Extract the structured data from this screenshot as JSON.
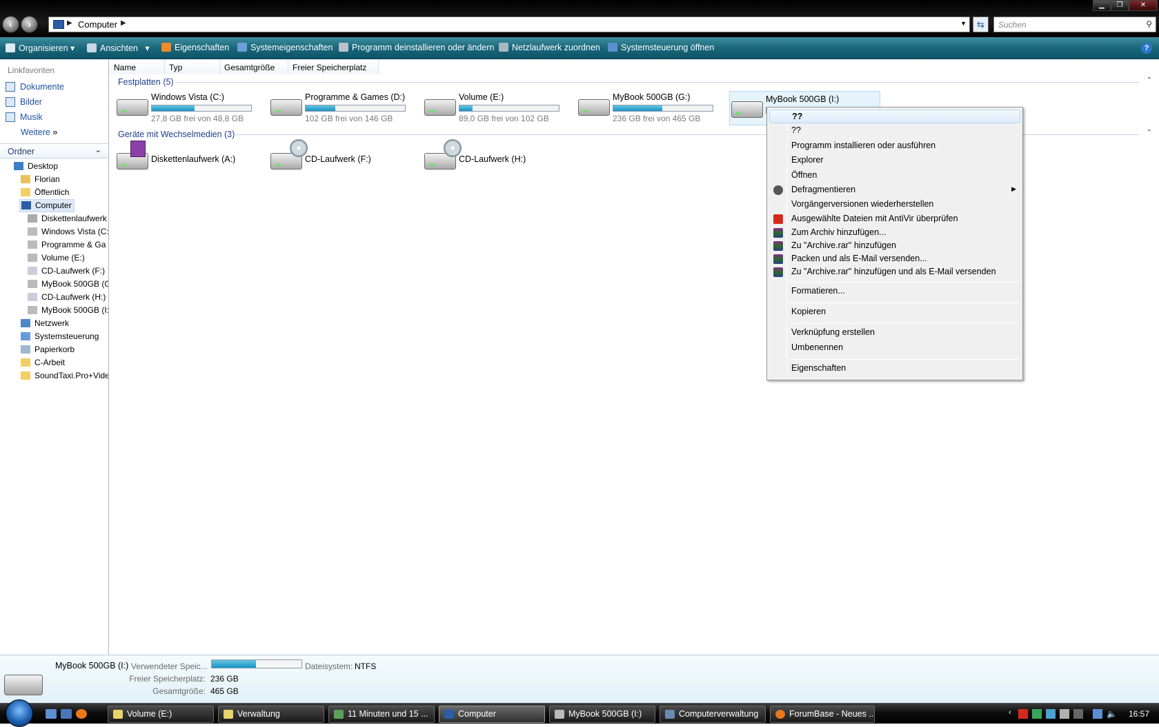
{
  "window": {
    "breadcrumb": "Computer",
    "search_placeholder": "Suchen"
  },
  "icons": {
    "back": "back-arrow-icon",
    "forward": "forward-arrow-icon",
    "computer": "computer-icon",
    "refresh": "refresh-icon",
    "search": "magnifier-icon"
  },
  "toolbar": {
    "organize": "Organisieren",
    "views": "Ansichten",
    "properties": "Eigenschaften",
    "system_properties": "Systemeigenschaften",
    "uninstall": "Programm deinstallieren oder ändern",
    "map_drive": "Netzlaufwerk zuordnen",
    "control_panel": "Systemsteuerung öffnen"
  },
  "nav": {
    "favorites_title": "Linkfavoriten",
    "favorites": [
      "Dokumente",
      "Bilder",
      "Musik",
      "Weitere"
    ],
    "folders_title": "Ordner",
    "tree": [
      "Desktop",
      "Florian",
      "Öffentlich",
      "Computer",
      "Diskettenlaufwerk",
      "Windows Vista (C:",
      "Programme & Ga",
      "Volume (E:)",
      "CD-Laufwerk (F:)",
      "MyBook 500GB (G",
      "CD-Laufwerk (H:)",
      "MyBook 500GB (I:",
      "Netzwerk",
      "Systemsteuerung",
      "Papierkorb",
      "C-Arbeit",
      "SoundTaxi.Pro+Vide"
    ]
  },
  "columns": [
    "Name",
    "Typ",
    "Gesamtgröße",
    "Freier Speicherplatz"
  ],
  "groups": {
    "hdd": "Festplatten (5)",
    "removable": "Geräte mit Wechselmedien (3)"
  },
  "drives": [
    {
      "name": "Windows Vista (C:)",
      "free": "27,8 GB frei von 48,8 GB",
      "used_fraction": 0.43
    },
    {
      "name": "Programme & Games (D:)",
      "free": "102 GB frei von 146 GB",
      "used_fraction": 0.3
    },
    {
      "name": "Volume (E:)",
      "free": "89,0 GB frei von 102 GB",
      "used_fraction": 0.13
    },
    {
      "name": "MyBook 500GB (G:)",
      "free": "236 GB frei von 465 GB",
      "used_fraction": 0.49
    },
    {
      "name": "MyBook 500GB (I:)",
      "free": "",
      "used_fraction": 0.49
    }
  ],
  "removable": [
    "Diskettenlaufwerk (A:)",
    "CD-Laufwerk (F:)",
    "CD-Laufwerk (H:)"
  ],
  "context_menu": [
    "??",
    "??",
    "Programm installieren oder ausführen",
    "Explorer",
    "Öffnen",
    "Defragmentieren",
    "Vorgängerversionen wiederherstellen",
    "Ausgewählte Dateien mit AntiVir überprüfen",
    "Zum Archiv hinzufügen...",
    "Zu \"Archive.rar\" hinzufügen",
    "Packen und als E-Mail versenden...",
    "Zu \"Archive.rar\" hinzufügen und als E-Mail versenden",
    "Formatieren...",
    "Kopieren",
    "Verknüpfung erstellen",
    "Umbenennen",
    "Eigenschaften"
  ],
  "details": {
    "name": "MyBook 500GB (I:)",
    "used_label": "Verwendeter Speic...",
    "used_fraction": 0.49,
    "fs_label": "Dateisystem:",
    "fs_value": "NTFS",
    "free_label": "Freier Speicherplatz:",
    "free_value": "236 GB",
    "total_label": "Gesamtgröße:",
    "total_value": "465 GB"
  },
  "taskbar": {
    "tasks": [
      "Volume (E:)",
      "Verwaltung",
      "11 Minuten und 15 ...",
      "Computer",
      "MyBook 500GB (I:)",
      "Computerverwaltung",
      "ForumBase - Neues ..."
    ],
    "clock": "16:57"
  },
  "colors": {
    "toolbar": "#19677b",
    "accent": "#1e50a2",
    "progress": "#1694c5"
  }
}
